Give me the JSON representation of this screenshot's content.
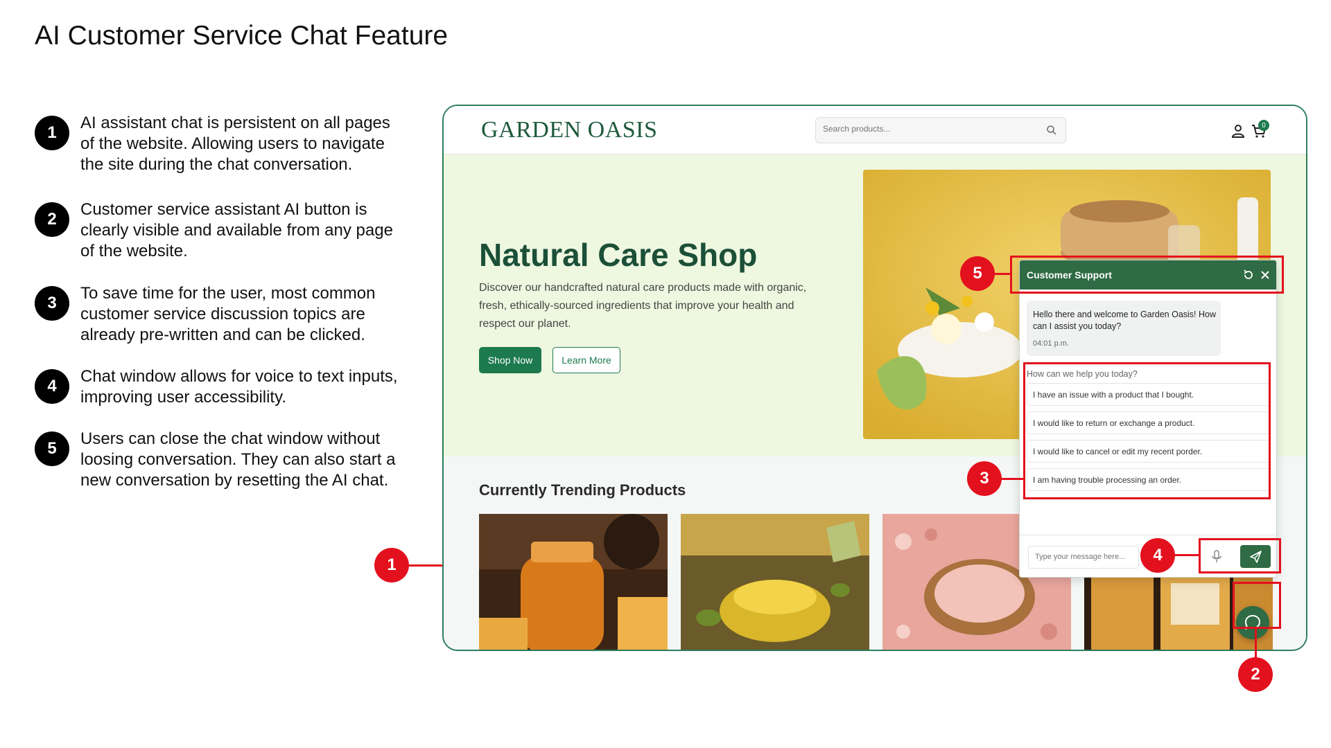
{
  "slide": {
    "title": "AI Customer Service Chat Feature"
  },
  "steps": [
    {
      "num": "1",
      "text": "AI assistant chat is persistent on all pages of the website. Allowing users to navigate the site during the chat conversation."
    },
    {
      "num": "2",
      "text": "Customer service assistant AI button is clearly visible and available from any page of the website."
    },
    {
      "num": "3",
      "text": "To save time for the user, most common customer service discussion topics are already pre-written and can be clicked."
    },
    {
      "num": "4",
      "text": "Chat window allows for voice to text inputs, improving user accessibility."
    },
    {
      "num": "5",
      "text": "Users can close the chat window without loosing conversation. They can also start a new conversation by resetting the AI chat."
    }
  ],
  "site": {
    "logo": "GARDEN OASIS",
    "search_placeholder": "Search products...",
    "cart_count": "0",
    "hero": {
      "title": "Natural Care Shop",
      "description": "Discover our handcrafted natural care products made with organic, fresh, ethically-sourced ingredients that improve your health and respect our  planet.",
      "shop_now": "Shop Now",
      "learn_more": "Learn More"
    },
    "trending_title": "Currently Trending Products"
  },
  "chat": {
    "title": "Customer Support",
    "welcome": "Hello there and welcome to Garden Oasis! How can I assist you today?",
    "time": "04:01 p.m.",
    "help_label": "How can we help you today?",
    "options": [
      "I have an issue with a product that I bought.",
      "I would like to return or exchange a product.",
      "I would like to cancel or edit my recent porder.",
      "I am having trouble processing an order."
    ],
    "input_placeholder": "Type your message here..."
  },
  "annotations": [
    "1",
    "2",
    "3",
    "4",
    "5"
  ],
  "colors": {
    "brand_green": "#1d7a4f",
    "chat_header": "#2f6b44",
    "hero_bg": "#eef7e0",
    "annotation_red": "#e3101d"
  },
  "icons": [
    "search-icon",
    "user-icon",
    "cart-icon",
    "reset-icon",
    "close-icon",
    "microphone-icon",
    "send-icon",
    "chat-bubble-icon"
  ]
}
